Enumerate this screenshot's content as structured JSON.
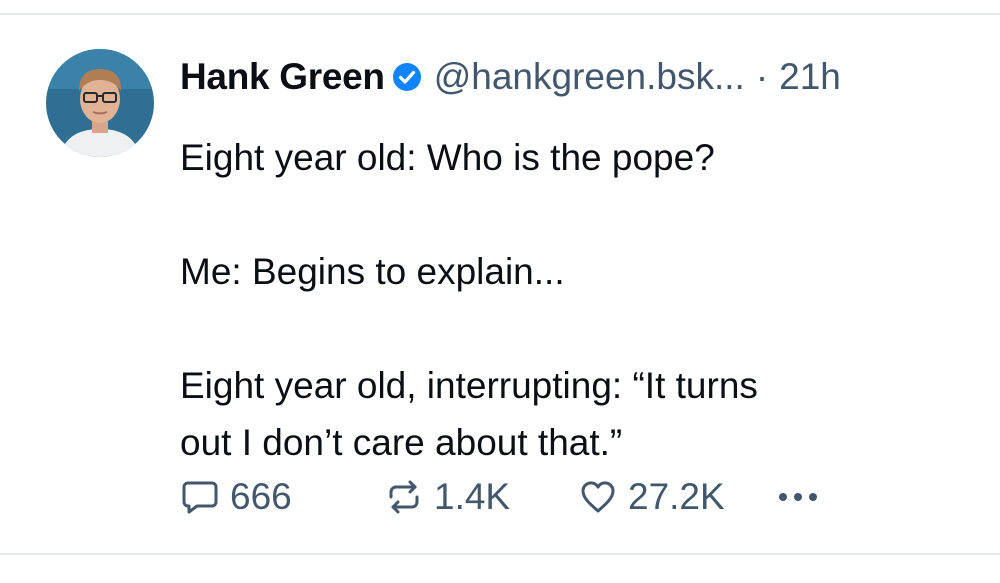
{
  "post": {
    "author": {
      "display_name": "Hank Green",
      "verified": true,
      "handle": "@hankgreen.bsk...",
      "separator": "·",
      "timestamp": "21h"
    },
    "text_lines": [
      "Eight year old: Who is the pope?",
      "",
      "Me: Begins to explain...",
      "",
      "Eight year old, interrupting: “It turns",
      "out I don’t care about that.”"
    ],
    "actions": {
      "reply_count": "666",
      "repost_count": "1.4K",
      "like_count": "27.2K"
    },
    "icons": {
      "reply": "speech-bubble-icon",
      "repost": "repost-arrows-icon",
      "like": "heart-icon",
      "more": "ellipsis-icon",
      "verified": "verified-check-icon"
    },
    "colors": {
      "text": "#0b0f14",
      "muted": "#42576c",
      "verified": "#1083fe",
      "divider": "#e4e8ec"
    }
  }
}
